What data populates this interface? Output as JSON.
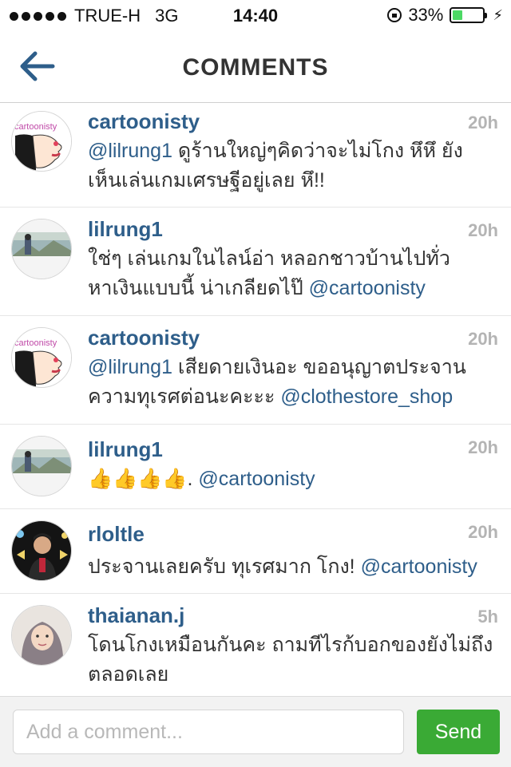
{
  "status_bar": {
    "carrier": "TRUE-H",
    "network": "3G",
    "time": "14:40",
    "battery_percent": "33%",
    "battery_level": 0.33,
    "battery_color": "#4cd964"
  },
  "nav": {
    "title": "COMMENTS",
    "back_icon": "back-arrow-icon"
  },
  "comments": [
    {
      "user": "cartoonisty",
      "time": "20h",
      "avatar": "cartoon-face-avatar",
      "mention": "@lilrung1",
      "body": " ดูร้านใหญ่ๆคิดว่าจะไม่โกง หึหึ ยังเห็นเล่นเกมเศรษฐีอยู่เลย หึ!!",
      "tail_mention": ""
    },
    {
      "user": "lilrung1",
      "time": "20h",
      "avatar": "landscape-photo-avatar",
      "mention": "",
      "body": "ใช่ๆ เล่นเกมในไลน์อ่า หลอกชาวบ้านไปทั่ว หาเงินแบบนี้ น่าเกลียดไป๊ ",
      "tail_mention": "@cartoonisty"
    },
    {
      "user": "cartoonisty",
      "time": "20h",
      "avatar": "cartoon-face-avatar",
      "mention": "@lilrung1",
      "body": " เสียดายเงินอะ ขออนุญาตประจานความทุเรศต่อนะคะะะ ",
      "tail_mention": "@clothestore_shop"
    },
    {
      "user": "lilrung1",
      "time": "20h",
      "avatar": "landscape-photo-avatar",
      "mention": "",
      "body": "👍👍👍👍. ",
      "tail_mention": "@cartoonisty"
    },
    {
      "user": "rloltle",
      "time": "20h",
      "avatar": "man-portrait-avatar",
      "mention": "",
      "body": "ประจานเลยครับ ทุเรศมาก โกง! ",
      "tail_mention": "@cartoonisty"
    },
    {
      "user": "thaianan.j",
      "time": "5h",
      "avatar": "woman-hijab-avatar",
      "mention": "",
      "body": "โดนโกงเหมือนกันคะ ถามทีไรก้บอกของยังไม่ถึงตลอดเลย",
      "tail_mention": ""
    }
  ],
  "composer": {
    "placeholder": "Add a comment...",
    "send_label": "Send",
    "send_color": "#3aaa35"
  },
  "colors": {
    "username": "#2e5e8a",
    "timestamp": "#b4b4b4"
  }
}
